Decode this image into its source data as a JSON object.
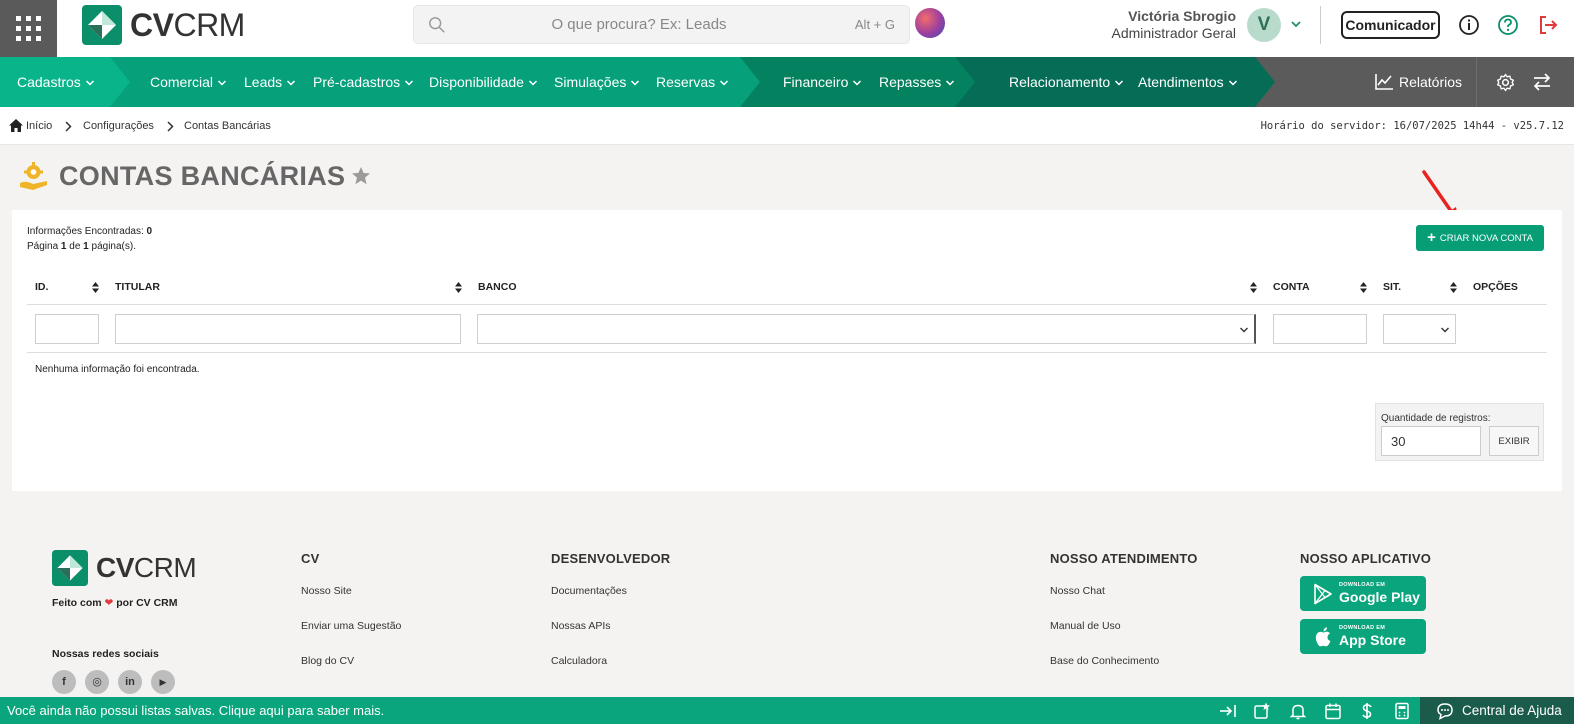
{
  "header": {
    "apps_icon": "grid-icon",
    "logo": {
      "bold": "CV",
      "light": "CRM"
    },
    "search": {
      "placeholder": "O que procura? Ex: Leads",
      "shortcut": "Alt + G"
    },
    "user": {
      "name": "Victória Sbrogio",
      "role": "Administrador Geral",
      "initial": "V"
    },
    "comunicador_label": "Comunicador",
    "icons": [
      "info-icon",
      "help-icon",
      "logout-icon"
    ]
  },
  "nav": {
    "items": [
      {
        "label": "Cadastros"
      },
      {
        "label": "Comercial"
      },
      {
        "label": "Leads"
      },
      {
        "label": "Pré-cadastros"
      },
      {
        "label": "Disponibilidade"
      },
      {
        "label": "Simulações"
      },
      {
        "label": "Reservas"
      },
      {
        "label": "Financeiro"
      },
      {
        "label": "Repasses"
      },
      {
        "label": "Relacionamento"
      },
      {
        "label": "Atendimentos"
      }
    ],
    "reports_label": "Relatórios"
  },
  "breadcrumb": {
    "items": [
      "Início",
      "Configurações",
      "Contas Bancárias"
    ],
    "server_time": "Horário do servidor: 16/07/2025 14h44 - v25.7.12"
  },
  "page": {
    "title": "CONTAS BANCÁRIAS",
    "info_found_label": "Informações Encontradas:",
    "info_found_value": "0",
    "page_word": "Página",
    "page_current": "1",
    "page_of": "de",
    "page_total": "1",
    "page_suffix": "página(s).",
    "create_button": "CRIAR NOVA CONTA",
    "columns": [
      "ID.",
      "TITULAR",
      "BANCO",
      "CONTA",
      "SIT.",
      "OPÇÕES"
    ],
    "empty_message": "Nenhuma informação foi encontrada.",
    "qty_label": "Quantidade de registros:",
    "qty_value": "30",
    "qty_button": "EXIBIR"
  },
  "footer": {
    "made_with_prefix": "Feito com",
    "made_with_suffix": "por CV CRM",
    "social_title": "Nossas redes sociais",
    "social": [
      {
        "icon": "facebook-icon",
        "glyph": "f"
      },
      {
        "icon": "instagram-icon",
        "glyph": "◎"
      },
      {
        "icon": "linkedin-icon",
        "glyph": "in"
      },
      {
        "icon": "youtube-icon",
        "glyph": "▶"
      }
    ],
    "cols": [
      {
        "title": "CV",
        "links": [
          "Nosso Site",
          "Enviar uma Sugestão",
          "Blog do CV"
        ]
      },
      {
        "title": "DESENVOLVEDOR",
        "links": [
          "Documentações",
          "Nossas APIs",
          "Calculadora"
        ]
      },
      {
        "title": "NOSSO ATENDIMENTO",
        "links": [
          "Nosso Chat",
          "Manual de Uso",
          "Base do Conhecimento"
        ]
      },
      {
        "title": "NOSSO APLICATIVO",
        "links": []
      }
    ],
    "stores": [
      {
        "small": "DOWNLOAD EM",
        "big": "Google Play"
      },
      {
        "small": "DOWNLOAD EM",
        "big": "App Store"
      }
    ]
  },
  "bottombar": {
    "message": "Você ainda não possui listas salvas. Clique aqui para saber mais.",
    "help_label": "Central de Ajuda"
  },
  "colors": {
    "brand_green": "#0aa57c",
    "nav_gray": "#5b5b5b",
    "dark_green": "#1b5b4c"
  }
}
